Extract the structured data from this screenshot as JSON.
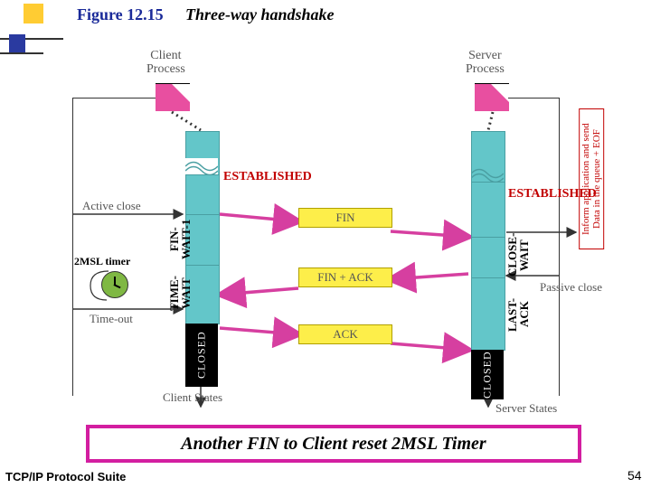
{
  "header": {
    "figure": "Figure 12.15",
    "title": "Three-way handshake"
  },
  "diagram": {
    "client_process": "Client\nProcess",
    "server_process": "Server\nProcess",
    "established": "ESTABLISHED",
    "active_close": "Active close",
    "passive_close": "Passive close",
    "timer_label": "2MSL timer",
    "timeout": "Time-out",
    "client_states_label": "Client States",
    "server_states_label": "Server States",
    "msg_fin": "FIN",
    "msg_finack": "FIN + ACK",
    "msg_ack": "ACK",
    "state_finwait1": "FIN-\nWAIT-1",
    "state_timewait": "TIME-\nWAIT",
    "state_closewait": "CLOSE-\nWAIT",
    "state_lastack": "LAST-\nACK",
    "state_closed": "CLOSED",
    "server_note": "Inform application and send\nData in the queue + EOF"
  },
  "callout": "Another FIN to Client reset 2MSL Timer",
  "footer": {
    "left": "TCP/IP Protocol Suite",
    "page": "54"
  }
}
